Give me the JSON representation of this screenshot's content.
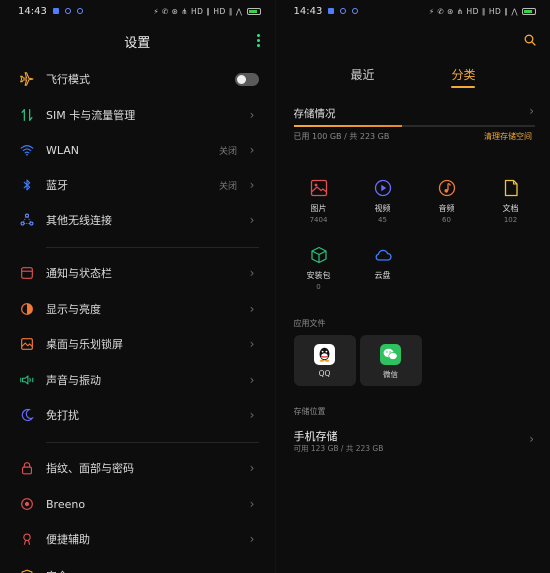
{
  "left": {
    "status": {
      "time": "14:43",
      "right_icons": "⚡ ✆ ⊛ ⋔ HD ∥ HD ∥ ⋀"
    },
    "title": "设置",
    "items": [
      {
        "label": "飞行模式",
        "icon": "airplane-icon",
        "color": "#f3a93a",
        "type": "toggle"
      },
      {
        "label": "SIM 卡与流量管理",
        "icon": "sim-data-icon",
        "color": "#29c27f",
        "type": "chevron"
      },
      {
        "label": "WLAN",
        "icon": "wifi-icon",
        "color": "#3f7dff",
        "value": "关闭",
        "type": "chevron"
      },
      {
        "label": "蓝牙",
        "icon": "bluetooth-icon",
        "color": "#3f7dff",
        "value": "关闭",
        "type": "chevron"
      },
      {
        "label": "其他无线连接",
        "icon": "connections-icon",
        "color": "#6b8cff",
        "type": "chevron"
      },
      {
        "label": "通知与状态栏",
        "icon": "notification-icon",
        "color": "#e05050",
        "type": "chevron"
      },
      {
        "label": "显示与亮度",
        "icon": "display-icon",
        "color": "#f07a3a",
        "type": "chevron"
      },
      {
        "label": "桌面与乐划锁屏",
        "icon": "wallpaper-icon",
        "color": "#f07a3a",
        "type": "chevron"
      },
      {
        "label": "声音与振动",
        "icon": "sound-icon",
        "color": "#29c27f",
        "type": "chevron"
      },
      {
        "label": "免打扰",
        "icon": "moon-icon",
        "color": "#6b6bff",
        "type": "chevron"
      },
      {
        "label": "指纹、面部与密码",
        "icon": "lock-icon",
        "color": "#e05050",
        "type": "chevron"
      },
      {
        "label": "Breeno",
        "icon": "breeno-icon",
        "color": "#e05050",
        "type": "chevron"
      },
      {
        "label": "便捷辅助",
        "icon": "assist-icon",
        "color": "#e05050",
        "type": "chevron"
      },
      {
        "label": "安全",
        "icon": "shield-icon",
        "color": "#f3a93a",
        "type": "chevron"
      }
    ]
  },
  "right": {
    "status": {
      "time": "14:43",
      "right_icons": "⚡ ✆ ⊛ ⋔ HD ∥ HD ∥ ⋀"
    },
    "tabs": [
      "最近",
      "分类"
    ],
    "storage": {
      "title": "存储情况",
      "used_text": "已用 100 GB / 共 223 GB",
      "clean_label": "清理存储空间",
      "used_fraction": 0.45
    },
    "categories": [
      {
        "name": "图片",
        "count": "7404",
        "icon": "image-icon",
        "color": "#e05050"
      },
      {
        "name": "视频",
        "count": "45",
        "icon": "video-icon",
        "color": "#6b6bff"
      },
      {
        "name": "音频",
        "count": "60",
        "icon": "audio-icon",
        "color": "#f07a3a"
      },
      {
        "name": "文档",
        "count": "102",
        "icon": "document-icon",
        "color": "#f3c23a"
      },
      {
        "name": "安装包",
        "count": "0",
        "icon": "package-icon",
        "color": "#29c27f"
      },
      {
        "name": "云盘",
        "count": "",
        "icon": "cloud-icon",
        "color": "#3f7dff"
      }
    ],
    "app_files_title": "应用文件",
    "apps": [
      {
        "name": "QQ",
        "icon": "qq-icon"
      },
      {
        "name": "微信",
        "icon": "wechat-icon"
      }
    ],
    "location_title": "存储位置",
    "phone_storage": {
      "label": "手机存储",
      "sub": "可用 123 GB / 共 223 GB"
    }
  }
}
